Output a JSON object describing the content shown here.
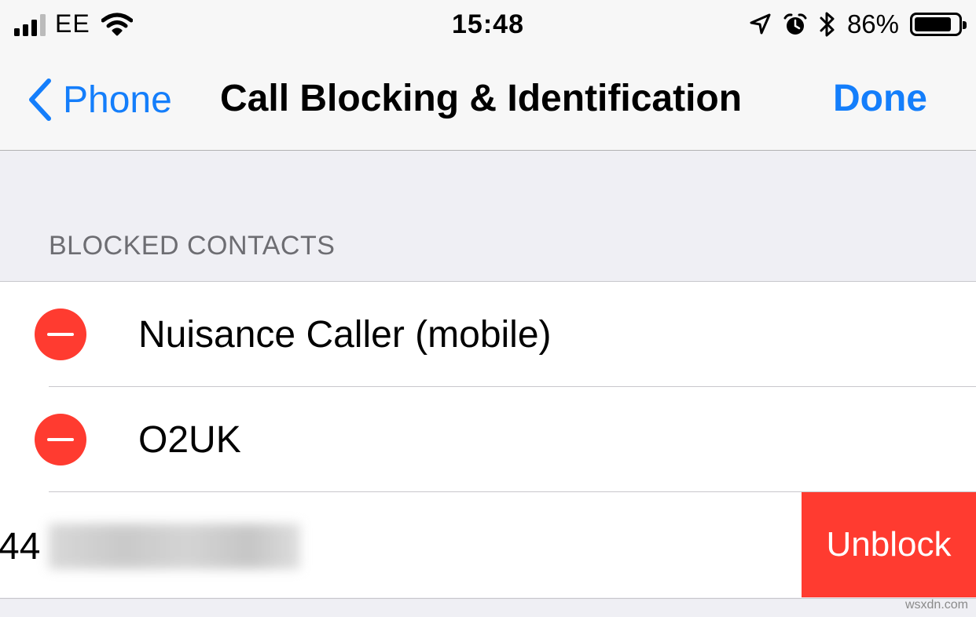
{
  "status_bar": {
    "carrier": "EE",
    "time": "15:48",
    "battery_percent": "86%",
    "battery_level": 0.86,
    "icons": [
      "signal-icon",
      "wifi-icon",
      "location-icon",
      "alarm-icon",
      "bluetooth-icon",
      "battery-icon"
    ]
  },
  "nav": {
    "back_label": "Phone",
    "title": "Call Blocking & Identification",
    "done_label": "Done"
  },
  "section": {
    "header": "BLOCKED CONTACTS"
  },
  "blocked_contacts": [
    {
      "name": "Nuisance Caller (mobile)"
    },
    {
      "name": "O2UK"
    },
    {
      "name_prefix": "44",
      "swipe_action": "Unblock"
    }
  ],
  "watermark": "wsxdn.com",
  "colors": {
    "accent": "#147efb",
    "destructive": "#ff3b30",
    "grouped_background": "#efeff4",
    "bar_background": "#f7f7f7"
  }
}
